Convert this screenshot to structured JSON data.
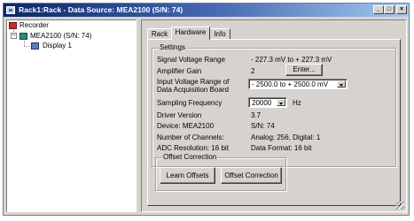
{
  "window": {
    "title": "Rack1:Rack - Data Source: MEA2100 (S/N: 74)",
    "caption_buttons": [
      "_",
      "□",
      "×"
    ]
  },
  "tree": {
    "items": [
      {
        "label": "Recorder",
        "icon": "recorder-icon"
      },
      {
        "label": "MEA2100 (S/N: 74)",
        "icon": "device-icon",
        "expander": "−"
      },
      {
        "label": "Display 1",
        "icon": "display-icon"
      }
    ]
  },
  "tabs": [
    "Rack",
    "Hardware",
    "Info"
  ],
  "active_tab": "Hardware",
  "settings": {
    "group_title": "Settings",
    "signal_voltage_range_label": "Signal Voltage Range",
    "signal_voltage_range_value": "- 227.3 mV to + 227.3 mV",
    "amplifier_gain_label": "Amplifier Gain",
    "amplifier_gain_value": "2",
    "enter_button": "Enter...",
    "input_voltage_label_line1": "Input Voltage Range of",
    "input_voltage_label_line2": "Data Acquisition Board",
    "input_voltage_value": "- 2500.0  to + 2500.0 mV",
    "sampling_frequency_label": "Sampling Frequency",
    "sampling_frequency_value": "20000",
    "sampling_frequency_unit": "Hz",
    "driver_version_label": "Driver Version",
    "driver_version_value": "3.7",
    "device_label": "Device: MEA2100",
    "device_value": "S/N: 74",
    "channels_label": "Number of Channels:",
    "channels_value": "Analog: 256, Digital: 1",
    "adc_label": "ADC Resolution: 16 bit",
    "adc_value": "Data Format: 16 bit"
  },
  "offset": {
    "group_title": "Offset Correction",
    "learn_button": "Learn Offsets",
    "correction_button": "Offset Correction"
  }
}
